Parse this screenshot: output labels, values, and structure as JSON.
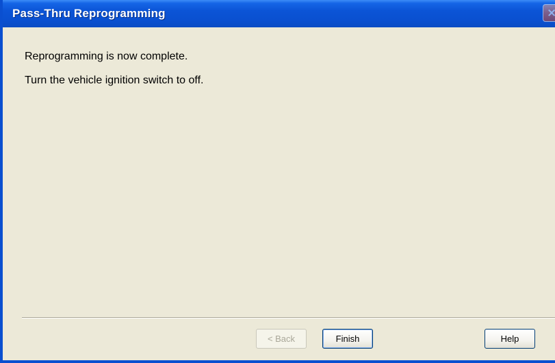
{
  "window": {
    "title": "Pass-Thru Reprogramming",
    "close_label": "×"
  },
  "content": {
    "message_line_1": "Reprogramming is now complete.",
    "message_line_2": "Turn the vehicle ignition switch to off."
  },
  "buttons": {
    "back_label": "< Back",
    "back_enabled": false,
    "finish_label": "Finish",
    "help_label": "Help"
  },
  "colors": {
    "titlebar": "#0a50d0",
    "dialog_background": "#ece9d8",
    "button_border": "#003c74"
  }
}
